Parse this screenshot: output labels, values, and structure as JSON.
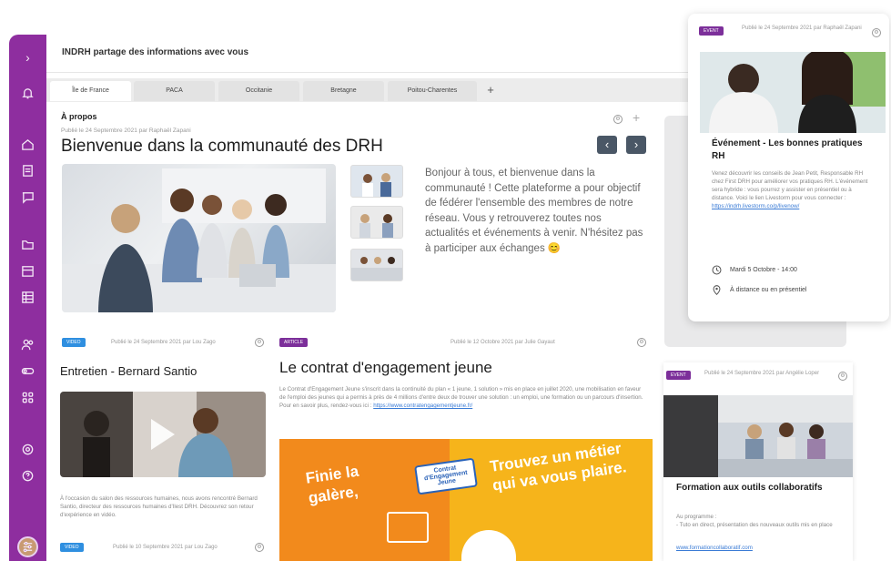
{
  "topbar": {
    "title": "INDRH partage des informations avec vous"
  },
  "tabs": [
    {
      "label": "Île de France",
      "active": true
    },
    {
      "label": "PACA",
      "active": false
    },
    {
      "label": "Occitanie",
      "active": false
    },
    {
      "label": "Bretagne",
      "active": false
    },
    {
      "label": "Poitou-Charentes",
      "active": false
    }
  ],
  "tab_add": "+",
  "about": {
    "label": "À propos",
    "meta": "Publié le 24 Septembre 2021 par Raphaël Zapani",
    "title": "Bienvenue dans la communauté des DRH",
    "intro": "Bonjour à tous, et bienvenue dans la communauté ! Cette plateforme a pour objectif de fédérer l'ensemble des membres de notre réseau. Vous y retrouverez toutes nos actualités et événements à venir. N'hésitez pas à participer aux échanges 😊",
    "prev": "‹",
    "next": "›"
  },
  "video_post": {
    "badge": "VIDEO",
    "meta": "Publié le 24 Septembre 2021 par Lou Zago",
    "title": "Entretien - Bernard Santio",
    "text": "À l'occasion du salon des ressources humaines, nous avons rencontré Bernard Santio, directeur des ressources humaines d'Ilest DRH. Découvrez son retour d'expérience en vidéo.",
    "footer_badge": "VIDEO",
    "footer_meta": "Publié le 10 Septembre 2021 par Lou Zago"
  },
  "article_post": {
    "badge": "ARTICLE",
    "meta": "Publié le 12 Octobre 2021 par Julie Gayaut",
    "title": "Le contrat d'engagement jeune",
    "text": "Le Contrat d'Engagement Jeune s'inscrit dans la continuité du plan « 1 jeune, 1 solution » mis en place en juillet 2020, une mobilisation en faveur de l'emploi des jeunes qui a permis à près de 4 millions d'entre deux de trouver une solution : un emploi, une formation ou un parcours d'insertion. Pour en savoir plus, rendez-vous ici :",
    "link": "https://www.contratengagementjeune.fr/",
    "banner_left": "Finie la galère,",
    "banner_badge": "Contrat d'Engagement Jeune",
    "banner_right": "Trouvez un métier qui va vous plaire."
  },
  "popup_event": {
    "badge": "EVENT",
    "meta": "Publié le 24 Septembre 2021 par Raphaël Zapani",
    "title": "Événement - Les bonnes pratiques RH",
    "text": "Venez découvrir les conseils de Jean Petit, Responsable RH chez First DRH pour améliorer vos pratiques RH. L'événement sera hybride : vous pourrez y assister en présentiel ou à distance. Voici le lien Livestorm pour vous connecter :",
    "link": "https://indrh.livestorm.co/p/livenow/",
    "date": "Mardi 5 Octobre - 14:00",
    "location": "À distance ou en présentiel"
  },
  "event_card": {
    "badge": "EVENT",
    "meta": "Publié le 24 Septembre 2021 par Angélie Loper",
    "title": "Formation aux outils collaboratifs",
    "text": "Au programme :\n - Tuto en direct, présentation des nouveaux outils mis en place",
    "link": "www.formationcollaboratif.com"
  },
  "colors": {
    "brand": "#8e2e9f",
    "blue": "#2f8fe0",
    "orange": "#f28a1c"
  }
}
